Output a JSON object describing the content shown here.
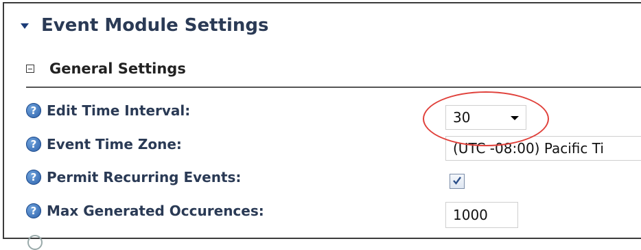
{
  "module": {
    "title": "Event Module Settings",
    "icon": "caret-down-icon"
  },
  "section": {
    "title": "General Settings",
    "toggle_icon": "collapse-minus-icon"
  },
  "help_icon_glyph": "?",
  "settings": {
    "edit_time_interval": {
      "label": "Edit Time Interval:",
      "value": "30"
    },
    "event_time_zone": {
      "label": "Event Time Zone:",
      "value": "(UTC -08:00) Pacific Ti"
    },
    "permit_recurring_events": {
      "label": "Permit Recurring Events:",
      "checked": true
    },
    "max_generated_occurences": {
      "label": "Max Generated Occurences:",
      "value": "1000"
    }
  },
  "annotation": {
    "color": "#e0403a"
  }
}
